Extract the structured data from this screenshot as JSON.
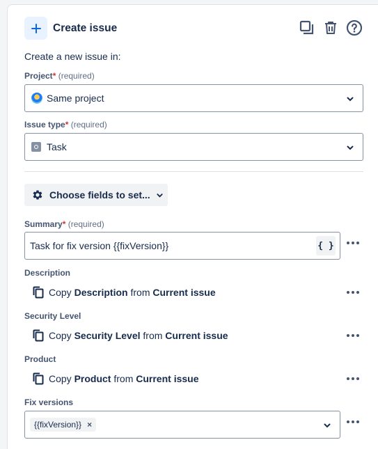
{
  "header": {
    "title": "Create issue",
    "add_icon": "plus-icon",
    "actions": [
      "duplicate-icon",
      "trash-icon",
      "help-icon"
    ]
  },
  "intro": "Create a new issue in:",
  "project": {
    "label": "Project",
    "required": "(required)",
    "value": "Same project"
  },
  "issue_type": {
    "label": "Issue type",
    "required": "(required)",
    "value": "Task"
  },
  "choose_fields": {
    "label": "Choose fields to set..."
  },
  "summary": {
    "label": "Summary",
    "required": "(required)",
    "value": "Task for fix version {{fixVersion}}",
    "smart_value_button": "{ }"
  },
  "copy_fields": [
    {
      "label": "Description",
      "prefix": "Copy",
      "field": "Description",
      "middle": "from",
      "source": "Current issue"
    },
    {
      "label": "Security Level",
      "prefix": "Copy",
      "field": "Security Level",
      "middle": "from",
      "source": "Current issue"
    },
    {
      "label": "Product",
      "prefix": "Copy",
      "field": "Product",
      "middle": "from",
      "source": "Current issue"
    }
  ],
  "fix_versions": {
    "label": "Fix versions",
    "tags": [
      "{{fixVersion}}"
    ],
    "remove_glyph": "×"
  },
  "colors": {
    "accent": "#0c66e4",
    "required_star": "#c9372c",
    "text": "#172b4d"
  }
}
